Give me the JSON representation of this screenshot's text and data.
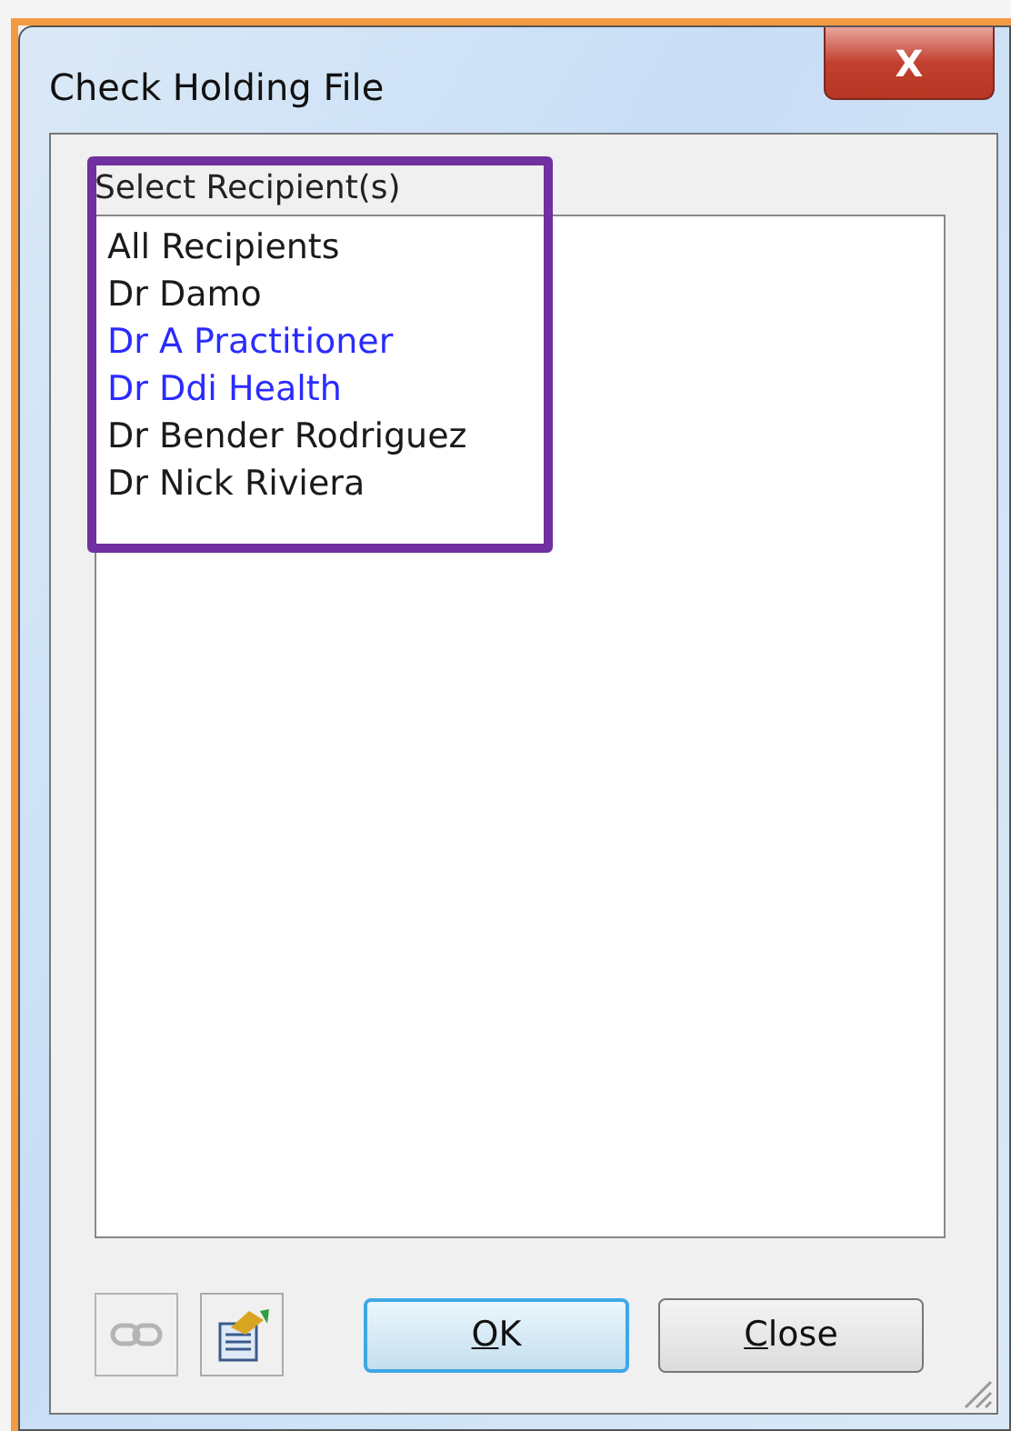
{
  "window": {
    "title": "Check Holding File",
    "close_glyph": "X"
  },
  "recipients": {
    "label": "Select Recipient(s)",
    "highlighted": true,
    "items": [
      {
        "name": "All Recipients",
        "color": "#1a1a1a"
      },
      {
        "name": "Dr Damo",
        "color": "#1a1a1a"
      },
      {
        "name": "Dr A Practitioner",
        "color": "#2b2bff"
      },
      {
        "name": "Dr Ddi Health",
        "color": "#2b2bff"
      },
      {
        "name": "Dr Bender Rodriguez",
        "color": "#1a1a1a"
      },
      {
        "name": "Dr Nick Riviera",
        "color": "#1a1a1a"
      }
    ]
  },
  "tools": [
    {
      "kind": "link",
      "disabled": true
    },
    {
      "kind": "edit",
      "disabled": false
    }
  ],
  "buttons": [
    {
      "label": "OK",
      "mnemonic": true,
      "default": true
    },
    {
      "label": "Close",
      "mnemonic": true,
      "default": false
    }
  ]
}
